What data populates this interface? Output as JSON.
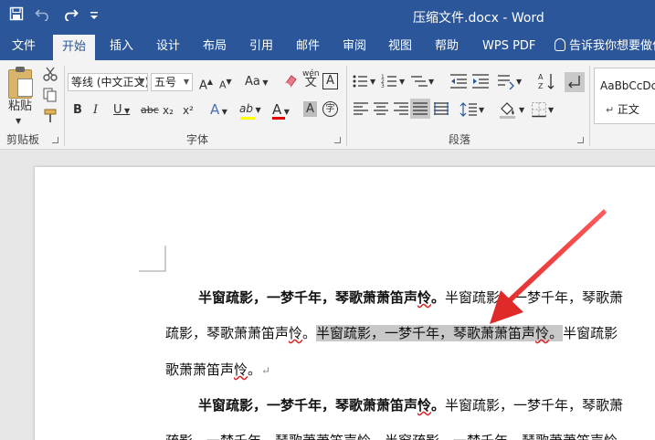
{
  "titlebar": {
    "save_icon": "save-icon",
    "undo_icon": "undo-icon",
    "redo_icon": "redo-icon",
    "customize_icon": "customize-qat-icon",
    "title": "压缩文件.docx  -  Word"
  },
  "tabs": {
    "items": [
      {
        "label": "文件"
      },
      {
        "label": "开始"
      },
      {
        "label": "插入"
      },
      {
        "label": "设计"
      },
      {
        "label": "布局"
      },
      {
        "label": "引用"
      },
      {
        "label": "邮件"
      },
      {
        "label": "审阅"
      },
      {
        "label": "视图"
      },
      {
        "label": "帮助"
      },
      {
        "label": "WPS PDF"
      }
    ],
    "active": "开始",
    "tell_me": "告诉我你想要做什么"
  },
  "ribbon": {
    "clipboard": {
      "label": "剪贴板",
      "paste_label": "粘贴"
    },
    "font": {
      "label": "字体",
      "font_name": "等线 (中文正文)",
      "font_size": "五号",
      "grow": "A",
      "shrink": "A",
      "change_case": "Aa",
      "phonetic": "wén",
      "char_border": "A",
      "bold": "B",
      "italic": "I",
      "underline": "U",
      "strike": "abc",
      "subscript": "x₂",
      "superscript": "x²",
      "text_effects": "A",
      "highlight": "ab",
      "font_color": "A",
      "char_shading": "A",
      "enclose": "字"
    },
    "paragraph": {
      "label": "段落"
    },
    "styles": {
      "sample": "AaBbCcDc",
      "name": "正文"
    },
    "colors": {
      "highlight": "#ffff00",
      "font_color": "#e00000",
      "accent": "#2b579a"
    }
  },
  "document": {
    "bold_phrase": "半窗疏影，一梦千年，琴歌萧萧笛声",
    "bold_last": "怜",
    "bold_stop": "。",
    "line1_rest": "半窗疏影，一梦千年，琴歌萧",
    "line2_a": "疏影，琴歌萧萧笛声",
    "line2_a_sq": "怜",
    "line2_a_stop": "。",
    "line2_sel": "半窗疏影，一梦千年，琴歌萧萧笛声",
    "line2_sel_sq": "怜",
    "line2_sel_stop": "。",
    "line2_rest": "半窗疏影",
    "line3_a": "歌萧萧笛声",
    "line3_sq": "怜",
    "line3_stop": "。",
    "pilcrow": "↵",
    "line5_partial": "疏影，一梦千年，琴歌萧萧笛声怜。半窗疏影，一梦千年，琴歌萧萧笛声怜"
  }
}
